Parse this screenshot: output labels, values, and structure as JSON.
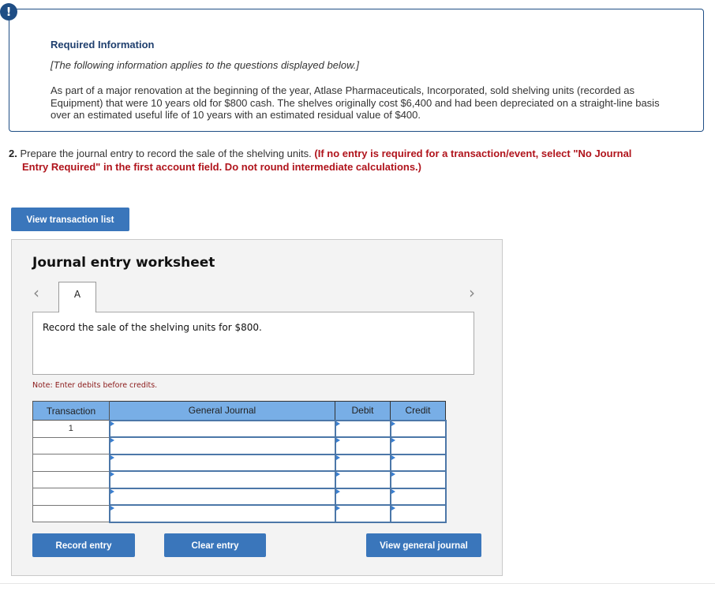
{
  "info": {
    "icon": "exclamation-icon",
    "title": "Required Information",
    "subtitle": "[The following information applies to the questions displayed below.]",
    "body": "As part of a major renovation at the beginning of the year, Atlase Pharmaceuticals, Incorporated, sold shelving units (recorded as Equipment) that were 10 years old for $800 cash. The shelves originally cost $6,400 and had been depreciated on a straight-line basis over an estimated useful life of 10 years with an estimated residual value of $400."
  },
  "question": {
    "number": "2.",
    "text": "Prepare the journal entry to record the sale of the shelving units.",
    "instruction_line1": "(If no entry is required for a transaction/event, select \"No Journal",
    "instruction_line2": "Entry Required\" in the first account field. Do not round intermediate calculations.)"
  },
  "buttons": {
    "view_transaction_list": "View transaction list",
    "record_entry": "Record entry",
    "clear_entry": "Clear entry",
    "view_general_journal": "View general journal"
  },
  "worksheet": {
    "title": "Journal entry worksheet",
    "prev_icon": "chevron-left-icon",
    "next_icon": "chevron-right-icon",
    "tabs": [
      {
        "label": "A",
        "active": true
      }
    ],
    "description": "Record the sale of the shelving units for $800.",
    "note": "Note: Enter debits before credits.",
    "table": {
      "headers": [
        "Transaction",
        "General Journal",
        "Debit",
        "Credit"
      ],
      "rows": [
        {
          "transaction": "1",
          "account": "",
          "debit": "",
          "credit": ""
        },
        {
          "transaction": "",
          "account": "",
          "debit": "",
          "credit": ""
        },
        {
          "transaction": "",
          "account": "",
          "debit": "",
          "credit": ""
        },
        {
          "transaction": "",
          "account": "",
          "debit": "",
          "credit": ""
        },
        {
          "transaction": "",
          "account": "",
          "debit": "",
          "credit": ""
        },
        {
          "transaction": "",
          "account": "",
          "debit": "",
          "credit": ""
        }
      ]
    }
  },
  "colors": {
    "primary_button": "#3a76bb",
    "header_fill": "#78aee6",
    "alert_navy": "#1f4e85",
    "instruction_red": "#b0141c"
  }
}
